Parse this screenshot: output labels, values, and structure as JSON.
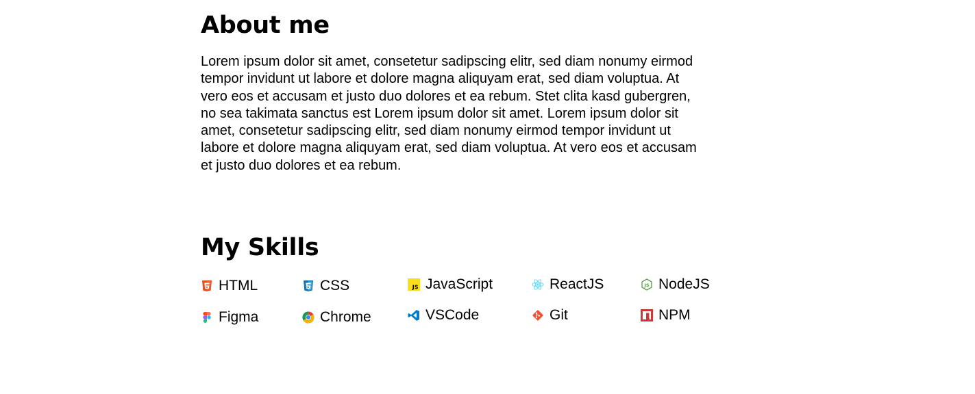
{
  "about": {
    "title": "About me",
    "text": "Lorem ipsum dolor sit amet, consetetur sadipscing elitr, sed diam nonumy eirmod tempor invidunt ut labore et dolore magna aliquyam erat, sed diam voluptua. At vero eos et accusam et justo duo dolores et ea rebum. Stet clita kasd gubergren, no sea takimata sanctus est Lorem ipsum dolor sit amet. Lorem ipsum dolor sit amet, consetetur sadipscing elitr, sed diam nonumy eirmod tempor invidunt ut labore et dolore magna aliquyam erat, sed diam voluptua. At vero eos et accusam et justo duo dolores et ea rebum."
  },
  "skills": {
    "title": "My Skills",
    "items": [
      {
        "label": "HTML",
        "icon": "html5-icon",
        "color": "#E44D26"
      },
      {
        "label": "CSS",
        "icon": "css3-icon",
        "color": "#1572B6"
      },
      {
        "label": "JavaScript",
        "icon": "javascript-icon",
        "color": "#F7DF1E"
      },
      {
        "label": "ReactJS",
        "icon": "react-icon",
        "color": "#61DAFB"
      },
      {
        "label": "NodeJS",
        "icon": "nodejs-icon",
        "color": "#539E43"
      },
      {
        "label": "Figma",
        "icon": "figma-icon",
        "color": "#F24E1E"
      },
      {
        "label": "Chrome",
        "icon": "chrome-icon",
        "color": "#4285F4"
      },
      {
        "label": "VSCode",
        "icon": "vscode-icon",
        "color": "#007ACC"
      },
      {
        "label": "Git",
        "icon": "git-icon",
        "color": "#F05032"
      },
      {
        "label": "NPM",
        "icon": "npm-icon",
        "color": "#CB3837"
      }
    ]
  }
}
